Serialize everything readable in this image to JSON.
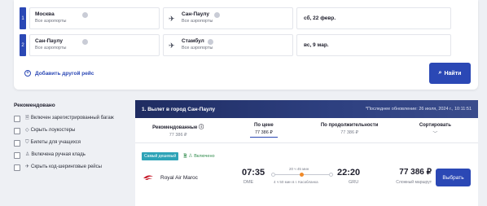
{
  "search": {
    "legs": [
      {
        "num": "1",
        "from_city": "Москва",
        "from_sub": "Все аэропорты",
        "to_city": "Сан-Паулу",
        "to_sub": "Все аэропорты",
        "date": "сб, 22 февр."
      },
      {
        "num": "2",
        "from_city": "Сан-Паулу",
        "from_sub": "Все аэропорты",
        "to_city": "Стамбул",
        "to_sub": "Все аэропорты",
        "date": "вс, 9 мар."
      }
    ],
    "add_route_label": "Добавить другой рейс",
    "find_label": "Найти"
  },
  "filters": {
    "title": "Рекомендовано",
    "items": [
      "Включен зарегистрированный багаж",
      "Скрыть лоукостеры",
      "Билеты для учащихся",
      "Включена ручная кладь",
      "Скрыть код-шеринговые рейсы"
    ]
  },
  "results": {
    "title": "1. Вылет в город Сан-Паулу",
    "updated": "*Последнее обновление: 26 июля, 2024 г., 10:11:51",
    "sort": {
      "recommended_label": "Рекомендованные",
      "recommended_price": "77 386 ₽",
      "cheapest_label": "По цене",
      "cheapest_price": "77 386 ₽",
      "fastest_label": "По продолжительности",
      "fastest_price": "77 386 ₽",
      "sort_label": "Сортировать"
    },
    "badge_cheapest": "Самый дешевый",
    "badge_bag": "Включено",
    "flight": {
      "airline": "Royal Air Maroc",
      "dep_time": "07:35",
      "dep_code": "DME",
      "duration": "20 ч 45 мин",
      "stop_info": "4 ч 50 мин в г. Касабланка",
      "arr_time": "22:20",
      "arr_code": "GRU",
      "price": "77 386 ₽",
      "price_note": "Сложный маршрут",
      "select_label": "Выбрать"
    }
  },
  "colors": {
    "accent": "#2b48b5",
    "header": "#1f2c61",
    "cheap_badge": "#2ea3b7",
    "stop": "#f08a2a"
  }
}
